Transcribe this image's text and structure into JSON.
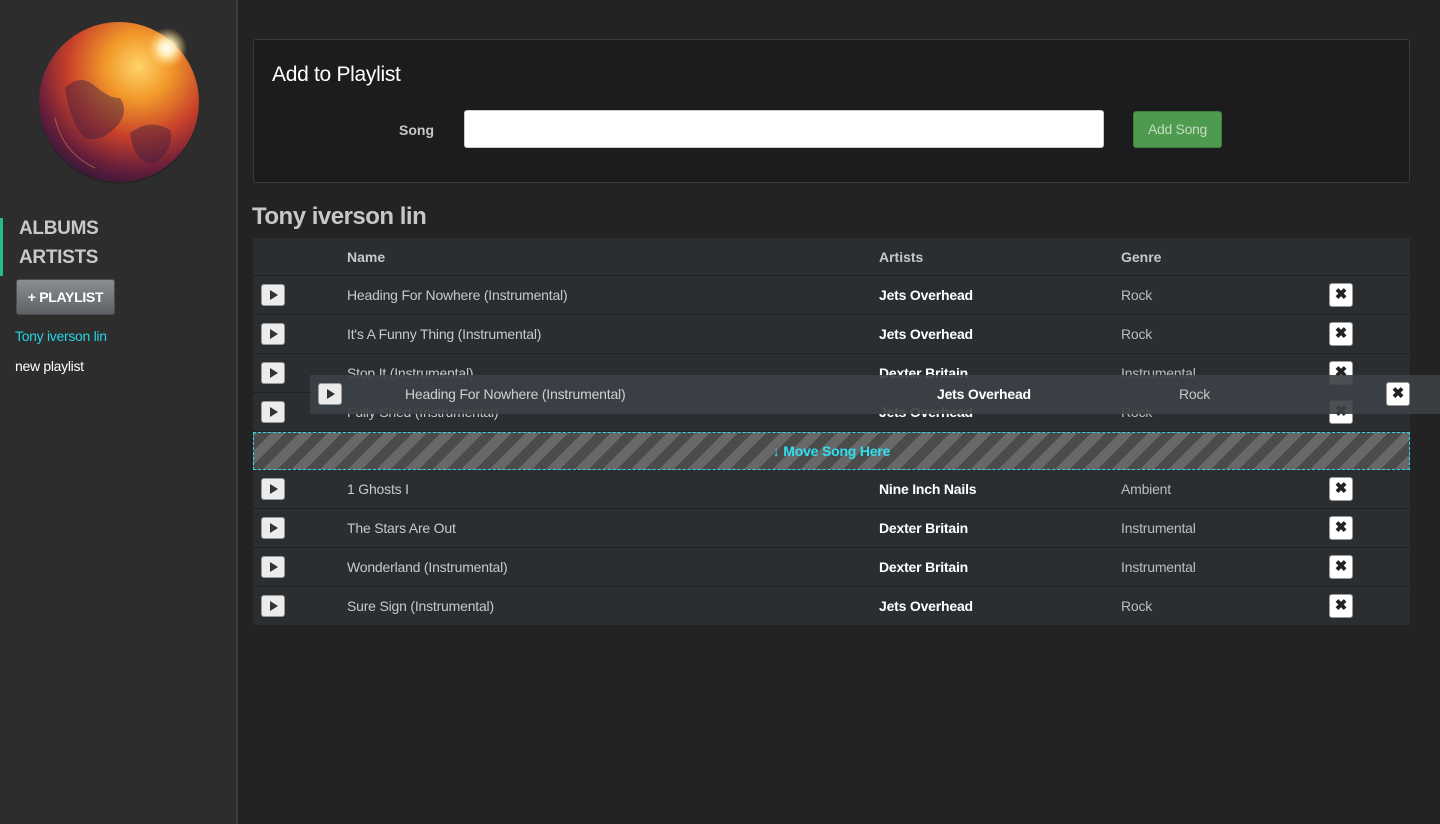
{
  "sidebar": {
    "nav": [
      {
        "label": "ALBUMS"
      },
      {
        "label": "ARTISTS"
      }
    ],
    "add_playlist_label": "+ PLAYLIST",
    "playlists": [
      {
        "label": "Tony iverson lin",
        "active": true
      },
      {
        "label": "new playlist",
        "active": false
      }
    ]
  },
  "add_panel": {
    "title": "Add to Playlist",
    "song_label": "Song",
    "song_value": "",
    "add_button_label": "Add Song"
  },
  "playlist": {
    "title": "Tony iverson lin",
    "columns": [
      "Name",
      "Artists",
      "Genre"
    ],
    "rows_before_drop": [
      {
        "name": "Heading For Nowhere (Instrumental)",
        "artist": "Jets Overhead",
        "genre": "Rock"
      },
      {
        "name": "It's A Funny Thing (Instrumental)",
        "artist": "Jets Overhead",
        "genre": "Rock"
      },
      {
        "name": "Stop It (Instrumental)",
        "artist": "Dexter Britain",
        "genre": "Instrumental"
      },
      {
        "name": "Fully Shed (Instrumental)",
        "artist": "Jets Overhead",
        "genre": "Rock"
      }
    ],
    "drop_zone_label": "↓ Move Song Here",
    "rows_after_drop": [
      {
        "name": "1 Ghosts I",
        "artist": "Nine Inch Nails",
        "genre": "Ambient"
      },
      {
        "name": "The Stars Are Out",
        "artist": "Dexter Britain",
        "genre": "Instrumental"
      },
      {
        "name": "Wonderland (Instrumental)",
        "artist": "Dexter Britain",
        "genre": "Instrumental"
      },
      {
        "name": "Sure Sign (Instrumental)",
        "artist": "Jets Overhead",
        "genre": "Rock"
      }
    ],
    "dragging_row": {
      "name": "Heading For Nowhere (Instrumental)",
      "artist": "Jets Overhead",
      "genre": "Rock"
    }
  },
  "icons": {
    "play": "play-icon",
    "delete": "close-icon",
    "logo": "firefox-globe-logo"
  },
  "colors": {
    "accent": "#27d3e4",
    "nav_indicator": "#28b88f",
    "add_song_button": "#4e9a4e"
  }
}
